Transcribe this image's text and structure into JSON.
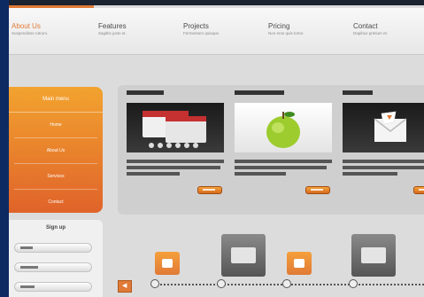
{
  "nav": {
    "items": [
      {
        "title": "About Us",
        "sub": "Suspendisse rutrum.",
        "active": true
      },
      {
        "title": "Features",
        "sub": "Sagittis justo et.",
        "active": false
      },
      {
        "title": "Projects",
        "sub": "Fermentum quisque.",
        "active": false
      },
      {
        "title": "Pricing",
        "sub": "Non eros quis tortor.",
        "active": false
      },
      {
        "title": "Contact",
        "sub": "Dapibus pretium et.",
        "active": false
      }
    ]
  },
  "sidebar": {
    "header": "Main menu",
    "items": [
      {
        "label": "Home"
      },
      {
        "label": "About Us"
      },
      {
        "label": "Services"
      },
      {
        "label": "Contact"
      }
    ]
  },
  "signup": {
    "title": "Sign up"
  },
  "colors": {
    "accent": "#e07a36",
    "background": "#0e2a63",
    "panel": "#cfcfcf"
  },
  "icons": [
    "chat-bubble-icon",
    "envelope-icon",
    "apple-icon",
    "arrow-left-icon"
  ]
}
